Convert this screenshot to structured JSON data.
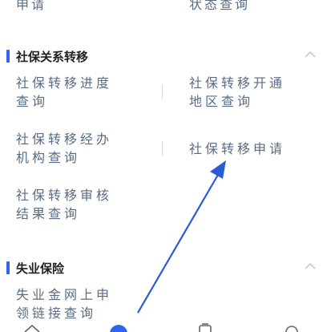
{
  "top_row": {
    "left_label": "申请",
    "right_label": "状态查询"
  },
  "sections": [
    {
      "title": "社保关系转移",
      "items": [
        {
          "line1": "社保转移进度",
          "line2": "查询"
        },
        {
          "line1": "社保转移开通",
          "line2": "地区查询"
        },
        {
          "line1": "社保转移经办",
          "line2": "机构查询"
        },
        {
          "line1": "社保转移申请",
          "line2": ""
        },
        {
          "line1": "社保转移审核",
          "line2": "结果查询"
        }
      ]
    },
    {
      "title": "失业保险",
      "items": [
        {
          "line1": "失业金网上申",
          "line2": "领链接查询"
        }
      ]
    }
  ],
  "colors": {
    "accent": "#2f64ee",
    "item_text": "#5a6b85",
    "arrow": "#2a5bd7"
  },
  "icons": {
    "chevron": "chevron-up-icon",
    "nav": [
      "home-icon",
      "center-circle-icon",
      "cup-icon",
      "search-icon"
    ]
  }
}
